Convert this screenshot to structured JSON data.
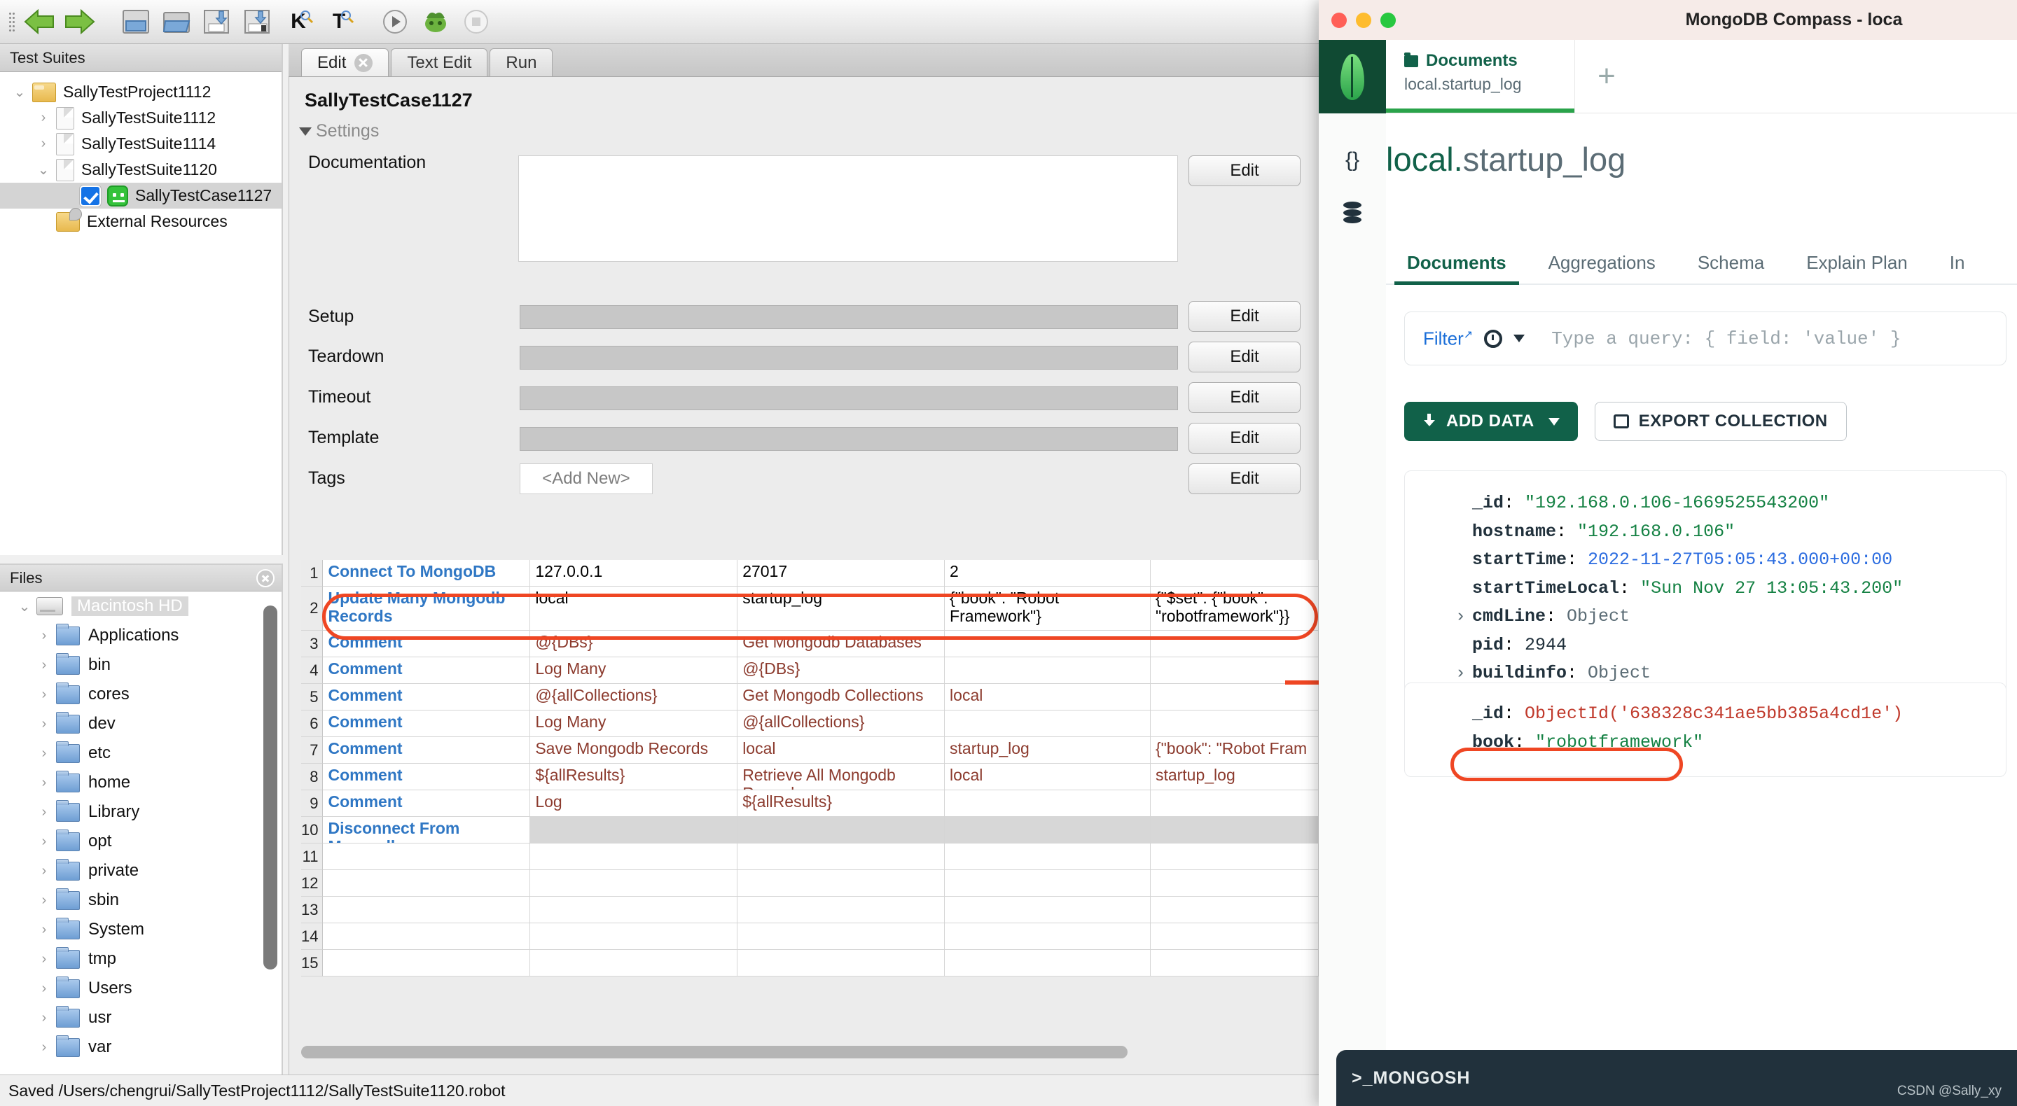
{
  "ride": {
    "toolbar": {
      "icons": [
        "back-arrow",
        "forward-arrow",
        "new-project",
        "open-folder",
        "save",
        "save-all",
        "keyword-search",
        "tag-search",
        "run",
        "robot",
        "stop"
      ],
      "k_label": "K",
      "t_label": "T"
    },
    "test_suites_panel": {
      "header": "Test Suites",
      "tree": [
        {
          "label": "SallyTestProject1112",
          "icon": "folder-icon",
          "twisty": "expanded",
          "indent": 0,
          "selected": false
        },
        {
          "label": "SallyTestSuite1112",
          "icon": "document-icon",
          "twisty": "collapsed",
          "indent": 1,
          "selected": false
        },
        {
          "label": "SallyTestSuite1114",
          "icon": "document-icon",
          "twisty": "collapsed",
          "indent": 1,
          "selected": false
        },
        {
          "label": "SallyTestSuite1120",
          "icon": "document-icon",
          "twisty": "expanded",
          "indent": 1,
          "selected": false
        },
        {
          "label": "SallyTestCase1127",
          "icon": "testcase-icon",
          "twisty": "none",
          "indent": 2,
          "selected": true,
          "checked": true
        },
        {
          "label": "External Resources",
          "icon": "external-resources-icon",
          "twisty": "none",
          "indent": 1,
          "selected": false
        }
      ]
    },
    "files_panel": {
      "header": "Files",
      "close_icon": "close-icon",
      "root": {
        "label": "Macintosh HD",
        "icon": "harddisk-icon",
        "twisty": "expanded"
      },
      "items": [
        "Applications",
        "bin",
        "cores",
        "dev",
        "etc",
        "home",
        "Library",
        "opt",
        "private",
        "sbin",
        "System",
        "tmp",
        "Users",
        "usr",
        "var"
      ]
    },
    "editor": {
      "tabs": [
        {
          "label": "Edit",
          "active": true,
          "closable": true
        },
        {
          "label": "Text Edit",
          "active": false,
          "closable": false
        },
        {
          "label": "Run",
          "active": false,
          "closable": false
        }
      ],
      "case_title": "SallyTestCase1127",
      "settings_header": "Settings",
      "settings_rows": [
        {
          "label": "Documentation",
          "value": "",
          "field_type": "textarea",
          "button": "Edit"
        },
        {
          "label": "Setup",
          "value": "",
          "field_type": "disabled",
          "button": "Edit"
        },
        {
          "label": "Teardown",
          "value": "",
          "field_type": "disabled",
          "button": "Edit"
        },
        {
          "label": "Timeout",
          "value": "",
          "field_type": "disabled",
          "button": "Edit"
        },
        {
          "label": "Template",
          "value": "",
          "field_type": "disabled",
          "button": "Edit"
        },
        {
          "label": "Tags",
          "value": "<Add New>",
          "field_type": "tag",
          "button": "Edit"
        }
      ],
      "grid_rows": [
        {
          "num": "1",
          "cells": [
            "Connect To MongoDB",
            "127.0.0.1",
            "27017",
            "2",
            ""
          ],
          "styles": [
            "kw",
            "plain",
            "plain",
            "plain",
            ""
          ],
          "tall": false
        },
        {
          "num": "2",
          "cells": [
            "Update Many Mongodb Records",
            "local",
            "startup_log",
            "{\"book\": \"Robot Framework\"}",
            "{\"$set\": {\"book\": \"robotframework\"}}"
          ],
          "styles": [
            "kw",
            "plain",
            "plain",
            "plain",
            "plain"
          ],
          "tall": true,
          "highlighted": true
        },
        {
          "num": "3",
          "cells": [
            "Comment",
            "@{DBs}",
            "Get Mongodb Databases",
            "",
            ""
          ],
          "styles": [
            "kw",
            "cmt",
            "cmt",
            "",
            ""
          ],
          "tall": false
        },
        {
          "num": "4",
          "cells": [
            "Comment",
            "Log Many",
            "@{DBs}",
            "",
            ""
          ],
          "styles": [
            "kw",
            "cmt",
            "cmt",
            "",
            ""
          ],
          "tall": false
        },
        {
          "num": "5",
          "cells": [
            "Comment",
            "@{allCollections}",
            "Get Mongodb Collections",
            "local",
            ""
          ],
          "styles": [
            "kw",
            "cmt",
            "cmt",
            "cmt",
            ""
          ],
          "tall": false
        },
        {
          "num": "6",
          "cells": [
            "Comment",
            "Log Many",
            "@{allCollections}",
            "",
            ""
          ],
          "styles": [
            "kw",
            "cmt",
            "cmt",
            "",
            ""
          ],
          "tall": false
        },
        {
          "num": "7",
          "cells": [
            "Comment",
            "Save Mongodb Records",
            "local",
            "startup_log",
            "{\"book\": \"Robot Fram"
          ],
          "styles": [
            "kw",
            "cmt",
            "cmt",
            "cmt",
            "cmt"
          ],
          "tall": false
        },
        {
          "num": "8",
          "cells": [
            "Comment",
            "${allResults}",
            "Retrieve All Mongodb Records",
            "local",
            "startup_log"
          ],
          "styles": [
            "kw",
            "cmt",
            "cmt",
            "cmt",
            "cmt"
          ],
          "tall": false
        },
        {
          "num": "9",
          "cells": [
            "Comment",
            "Log",
            "${allResults}",
            "",
            ""
          ],
          "styles": [
            "kw",
            "cmt",
            "cmt",
            "",
            ""
          ],
          "tall": false
        },
        {
          "num": "10",
          "cells": [
            "Disconnect From Mongodb",
            "",
            "",
            "",
            ""
          ],
          "styles": [
            "kw",
            "gray",
            "gray",
            "gray",
            "gray"
          ],
          "tall": false
        },
        {
          "num": "11",
          "cells": [
            "",
            "",
            "",
            "",
            ""
          ],
          "styles": [
            "",
            "",
            "",
            "",
            ""
          ],
          "tall": false
        },
        {
          "num": "12",
          "cells": [
            "",
            "",
            "",
            "",
            ""
          ],
          "styles": [
            "",
            "",
            "",
            "",
            ""
          ],
          "tall": false
        },
        {
          "num": "13",
          "cells": [
            "",
            "",
            "",
            "",
            ""
          ],
          "styles": [
            "",
            "",
            "",
            "",
            ""
          ],
          "tall": false
        },
        {
          "num": "14",
          "cells": [
            "",
            "",
            "",
            "",
            ""
          ],
          "styles": [
            "",
            "",
            "",
            "",
            ""
          ],
          "tall": false
        },
        {
          "num": "15",
          "cells": [
            "",
            "",
            "",
            "",
            ""
          ],
          "styles": [
            "",
            "",
            "",
            "",
            ""
          ],
          "tall": false
        }
      ]
    },
    "statusbar": {
      "text": "Saved /Users/chengrui/SallyTestProject1112/SallyTestSuite1120.robot"
    }
  },
  "compass": {
    "window_title": "MongoDB Compass - loca",
    "traffic_lights": {
      "close": "#ff5f57",
      "minimize": "#febc2e",
      "zoom": "#28c840"
    },
    "rail_icons": [
      "mongodb-leaf-icon",
      "braces-icon",
      "database-icon"
    ],
    "tab": {
      "title": "Documents",
      "subtitle": "local.startup_log",
      "icon": "documents-folder-icon"
    },
    "new_tab_label": "+",
    "namespace": {
      "db": "local.",
      "collection": "startup_log"
    },
    "view_tabs": [
      {
        "label": "Documents",
        "active": true
      },
      {
        "label": "Aggregations",
        "active": false
      },
      {
        "label": "Schema",
        "active": false
      },
      {
        "label": "Explain Plan",
        "active": false
      },
      {
        "label": "In",
        "active": false
      }
    ],
    "filter": {
      "label": "Filter",
      "placeholder": "Type a query: { field: 'value' }",
      "history_icon": "clock-icon",
      "external_icon": "external-link-icon"
    },
    "buttons": {
      "add_data": "ADD DATA",
      "export_collection": "EXPORT COLLECTION"
    },
    "document1": [
      {
        "key": "_id",
        "sep": ": ",
        "value": "\"192.168.0.106-1669525543200\"",
        "vtype": "vstr",
        "expand": ""
      },
      {
        "key": "hostname",
        "sep": ": ",
        "value": "\"192.168.0.106\"",
        "vtype": "vstr",
        "expand": ""
      },
      {
        "key": "startTime",
        "sep": ": ",
        "value": "2022-11-27T05:05:43.000+00:00",
        "vtype": "vdate",
        "expand": ""
      },
      {
        "key": "startTimeLocal",
        "sep": ": ",
        "value": "\"Sun Nov 27 13:05:43.200\"",
        "vtype": "vstr",
        "expand": ""
      },
      {
        "key": "cmdLine",
        "sep": ": ",
        "value": "Object",
        "vtype": "vobj",
        "expand": "›"
      },
      {
        "key": "pid",
        "sep": ": ",
        "value": "2944",
        "vtype": "vnum",
        "expand": ""
      },
      {
        "key": "buildinfo",
        "sep": ": ",
        "value": "Object",
        "vtype": "vobj",
        "expand": "›"
      }
    ],
    "document2": [
      {
        "key": "_id",
        "sep": ": ",
        "value": "ObjectId('638328c341ae5bb385a4cd1e')",
        "vtype": "void",
        "expand": ""
      },
      {
        "key": "book",
        "sep": ": ",
        "value": "\"robotframework\"",
        "vtype": "vstr",
        "expand": ""
      }
    ],
    "mongosh": {
      "label": ">_MONGOSH",
      "watermark": "CSDN @Sally_xy"
    }
  },
  "annotations": {
    "accent": "#ef4623"
  }
}
